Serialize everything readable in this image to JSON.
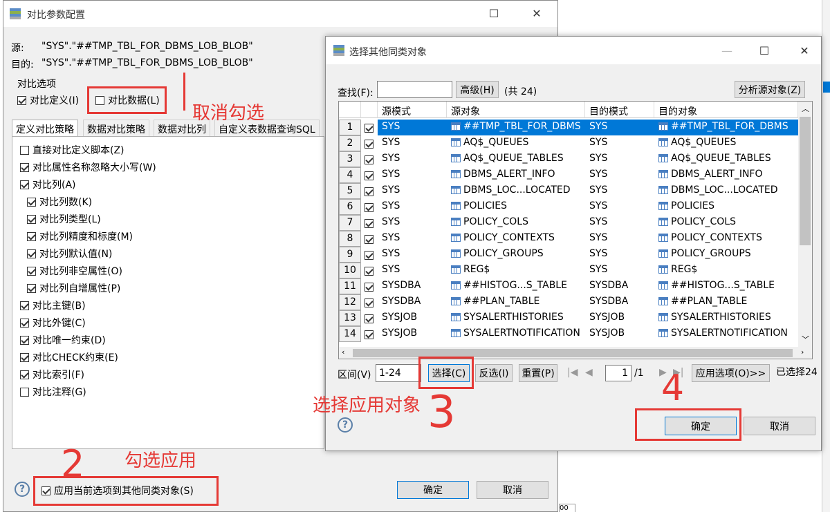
{
  "main_dialog": {
    "title": "对比参数配置",
    "source_label": "源:",
    "source_value": "\"SYS\".\"##TMP_TBL_FOR_DBMS_LOB_BLOB\"",
    "target_label": "目的:",
    "target_value": "\"SYS\".\"##TMP_TBL_FOR_DBMS_LOB_BLOB\"",
    "compare_group": "对比选项",
    "compare_def": "对比定义(I)",
    "compare_data": "对比数据(L)",
    "tabs": [
      "定义对比策略",
      "数据对比策略",
      "数据对比列",
      "自定义表数据查询SQL"
    ],
    "options": [
      {
        "label": "直接对比定义脚本(Z)",
        "checked": false,
        "indent": false
      },
      {
        "label": "对比属性名称忽略大小写(W)",
        "checked": true,
        "indent": false
      },
      {
        "label": "对比列(A)",
        "checked": true,
        "indent": false
      },
      {
        "label": "对比列数(K)",
        "checked": true,
        "indent": true
      },
      {
        "label": "对比列类型(L)",
        "checked": true,
        "indent": true
      },
      {
        "label": "对比列精度和标度(M)",
        "checked": true,
        "indent": true
      },
      {
        "label": "对比列默认值(N)",
        "checked": true,
        "indent": true
      },
      {
        "label": "对比列非空属性(O)",
        "checked": true,
        "indent": true
      },
      {
        "label": "对比列自增属性(P)",
        "checked": true,
        "indent": true
      },
      {
        "label": "对比主键(B)",
        "checked": true,
        "indent": false
      },
      {
        "label": "对比外键(C)",
        "checked": true,
        "indent": false
      },
      {
        "label": "对比唯一约束(D)",
        "checked": true,
        "indent": false
      },
      {
        "label": "对比CHECK约束(E)",
        "checked": true,
        "indent": false
      },
      {
        "label": "对比索引(F)",
        "checked": true,
        "indent": false
      },
      {
        "label": "对比注释(G)",
        "checked": false,
        "indent": false
      }
    ],
    "apply_option": "应用当前选项到其他同类对象(S)",
    "ok": "确定",
    "cancel": "取消"
  },
  "select_dialog": {
    "title": "选择其他同类对象",
    "search_label": "查找(F):",
    "search_value": "",
    "advanced": "高级(H)",
    "count": "(共 24)",
    "analyze": "分析源对象(Z)",
    "columns": [
      "源模式",
      "源对象",
      "目的模式",
      "目的对象"
    ],
    "rows": [
      {
        "n": "1",
        "sm": "SYS",
        "so": "##TMP_TBL_FOR_DBMS",
        "tm": "SYS",
        "to": "##TMP_TBL_FOR_DBMS"
      },
      {
        "n": "2",
        "sm": "SYS",
        "so": "AQ$_QUEUES",
        "tm": "SYS",
        "to": "AQ$_QUEUES"
      },
      {
        "n": "3",
        "sm": "SYS",
        "so": "AQ$_QUEUE_TABLES",
        "tm": "SYS",
        "to": "AQ$_QUEUE_TABLES"
      },
      {
        "n": "4",
        "sm": "SYS",
        "so": "DBMS_ALERT_INFO",
        "tm": "SYS",
        "to": "DBMS_ALERT_INFO"
      },
      {
        "n": "5",
        "sm": "SYS",
        "so": "DBMS_LOC...LOCATED",
        "tm": "SYS",
        "to": "DBMS_LOC...LOCATED"
      },
      {
        "n": "6",
        "sm": "SYS",
        "so": "POLICIES",
        "tm": "SYS",
        "to": "POLICIES"
      },
      {
        "n": "7",
        "sm": "SYS",
        "so": "POLICY_COLS",
        "tm": "SYS",
        "to": "POLICY_COLS"
      },
      {
        "n": "8",
        "sm": "SYS",
        "so": "POLICY_CONTEXTS",
        "tm": "SYS",
        "to": "POLICY_CONTEXTS"
      },
      {
        "n": "9",
        "sm": "SYS",
        "so": "POLICY_GROUPS",
        "tm": "SYS",
        "to": "POLICY_GROUPS"
      },
      {
        "n": "10",
        "sm": "SYS",
        "so": "REG$",
        "tm": "SYS",
        "to": "REG$"
      },
      {
        "n": "11",
        "sm": "SYSDBA",
        "so": "##HISTOG...S_TABLE",
        "tm": "SYSDBA",
        "to": "##HISTOG...S_TABLE"
      },
      {
        "n": "12",
        "sm": "SYSDBA",
        "so": "##PLAN_TABLE",
        "tm": "SYSDBA",
        "to": "##PLAN_TABLE"
      },
      {
        "n": "13",
        "sm": "SYSJOB",
        "so": "SYSALERTHISTORIES",
        "tm": "SYSJOB",
        "to": "SYSALERTHISTORIES"
      },
      {
        "n": "14",
        "sm": "SYSJOB",
        "so": "SYSALERTNOTIFICATION",
        "tm": "SYSJOB",
        "to": "SYSALERTNOTIFICATION"
      }
    ],
    "range_label": "区间(V)",
    "range_value": "1-24",
    "select_btn": "选择(C)",
    "invert_btn": "反选(I)",
    "reset_btn": "重置(P)",
    "page_value": "1",
    "page_total": "/1",
    "apply_opts": "应用选项(O)>>",
    "selected_info": "已选择24",
    "ok": "确定",
    "cancel": "取消"
  },
  "annotations": {
    "uncheck": "取消勾选",
    "check_apply": "勾选应用",
    "select_apply": "选择应用对象",
    "num2": "2",
    "num3": "3",
    "num4": "4"
  }
}
